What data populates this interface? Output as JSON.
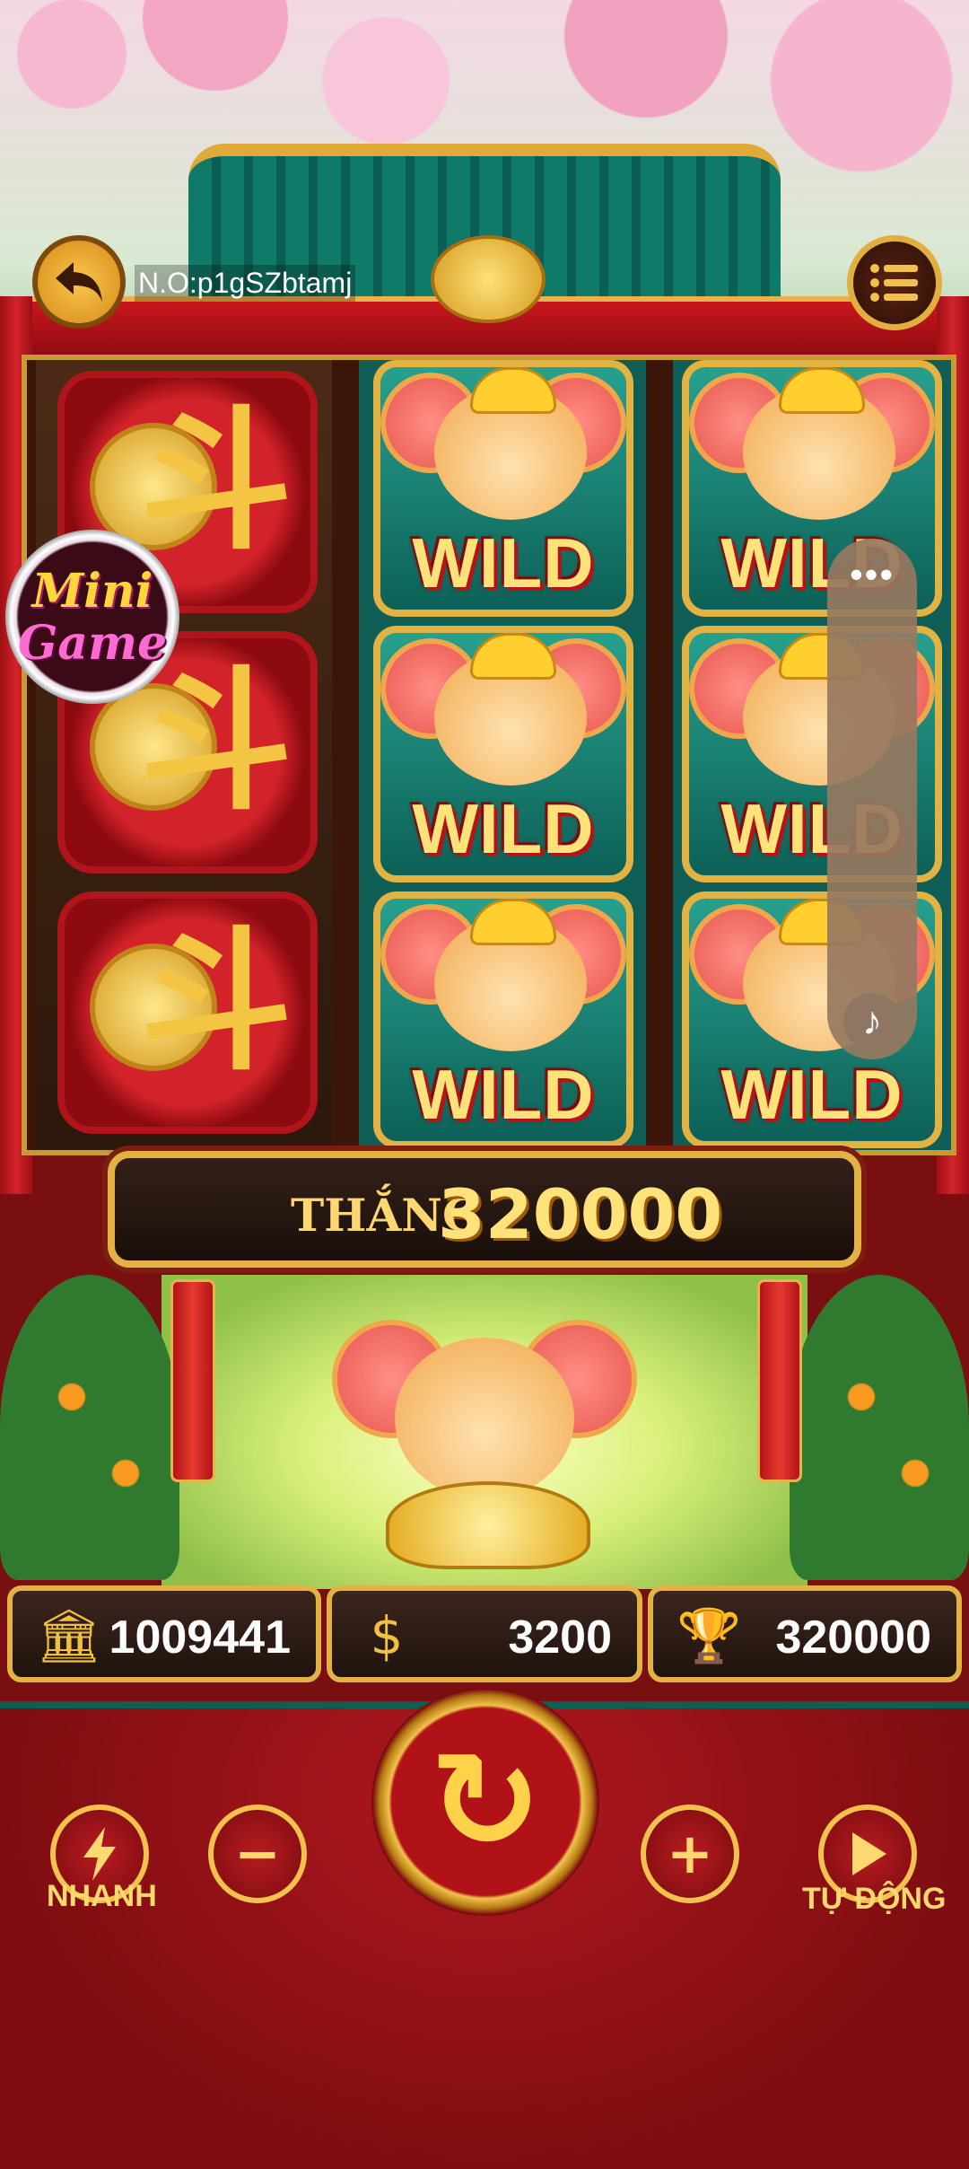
{
  "header": {
    "order_id": "N.O:p1gSZbtamj"
  },
  "badge": {
    "line1": "Mini",
    "line2": "Game"
  },
  "reels": {
    "wild_label": "WILD",
    "fortune_glyph": "斗"
  },
  "win": {
    "label": "THẮNG",
    "value": "320000"
  },
  "stats": {
    "balance": "1009441",
    "bet": "3200",
    "win_total": "320000"
  },
  "controls": {
    "turbo_label": "NHANH",
    "auto_label": "TỰ ĐỘNG",
    "minus_glyph": "−",
    "plus_glyph": "+"
  },
  "icons": {
    "back": "back-arrow-icon",
    "menu": "menu-list-icon",
    "more": "more-dots-icon",
    "music": "music-note-icon",
    "balance": "bank-icon",
    "bet": "coin-icon",
    "win": "trophy-icon",
    "turbo": "lightning-icon",
    "spin": "spin-icon",
    "auto": "play-icon"
  }
}
